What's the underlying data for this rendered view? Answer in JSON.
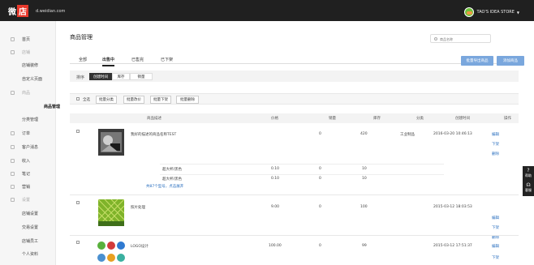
{
  "header": {
    "logo_main": "微",
    "logo_badge": "店",
    "domain": "d.weidian.com",
    "store_name": "TAO'S IDEA STORE",
    "caret": "▼"
  },
  "sidebar": {
    "items": [
      {
        "label": "首页",
        "type": "top"
      },
      {
        "label": "店铺",
        "type": "group"
      },
      {
        "label": "店铺装修",
        "type": "sub"
      },
      {
        "label": "自定义页面",
        "type": "sub"
      },
      {
        "label": "商品",
        "type": "group"
      },
      {
        "label": "商品管理",
        "type": "sub"
      },
      {
        "label": "分类管理",
        "type": "sub"
      },
      {
        "label": "订单",
        "type": "top"
      },
      {
        "label": "客户消息",
        "type": "top"
      },
      {
        "label": "收入",
        "type": "top"
      },
      {
        "label": "笔记",
        "type": "top"
      },
      {
        "label": "营销",
        "type": "top"
      },
      {
        "label": "设置",
        "type": "group"
      },
      {
        "label": "店铺设置",
        "type": "sub"
      },
      {
        "label": "交易设置",
        "type": "sub"
      },
      {
        "label": "店铺员工",
        "type": "sub"
      },
      {
        "label": "个人资料",
        "type": "sub"
      }
    ]
  },
  "page": {
    "title": "商品管理",
    "search_placeholder": "商品名称"
  },
  "tabs": [
    "全部",
    "出售中",
    "已售完",
    "已下架"
  ],
  "buttons": {
    "batch_export": "批量导出商品",
    "add_product": "添加商品"
  },
  "sort": {
    "label": "排序",
    "options": [
      "创建时间",
      "库存",
      "销量"
    ]
  },
  "actions": {
    "select_all": "全选",
    "items": [
      "批量分类",
      "批量改价",
      "批量下架",
      "批量删除"
    ]
  },
  "table": {
    "headers": [
      "商品描述",
      "价格",
      "销量",
      "库存",
      "分类",
      "创建时间",
      "操作"
    ],
    "rows": [
      {
        "name": "我好的描述的商品名称TEST",
        "price": "",
        "sales": "0",
        "stock": "420",
        "category": "工业制品",
        "created": "2016-03-20 10:46:13",
        "ops": [
          "编辑",
          "下架",
          "删除"
        ],
        "skus": [
          {
            "name": "超大杯/黑色",
            "price": "0.10",
            "sales": "0",
            "stock": "10"
          },
          {
            "name": "超大杯/黑色",
            "price": "0.10",
            "sales": "0",
            "stock": "10"
          }
        ],
        "more": "共87个型号，点击展开"
      },
      {
        "name": "照片处理",
        "price": "9.00",
        "sales": "0",
        "stock": "100",
        "category": "",
        "created": "2015-03-12 18:03:53",
        "ops": [
          "编辑",
          "下架",
          "删除"
        ],
        "skus": [],
        "more": ""
      },
      {
        "name": "LOGO设计",
        "price": "100.00",
        "sales": "0",
        "stock": "99",
        "category": "",
        "created": "2015-03-12 17:51:37",
        "ops": [
          "编辑",
          "下架"
        ],
        "skus": [],
        "more": ""
      }
    ]
  },
  "side_tools": [
    {
      "glyph": "?",
      "label": "帮助"
    },
    {
      "glyph": "☊",
      "label": "客服"
    }
  ],
  "colors": {
    "topbar": "#202020",
    "accent_blue": "#7aa7dd",
    "link": "#2a6fbf",
    "logo_red": "#e8392c"
  }
}
